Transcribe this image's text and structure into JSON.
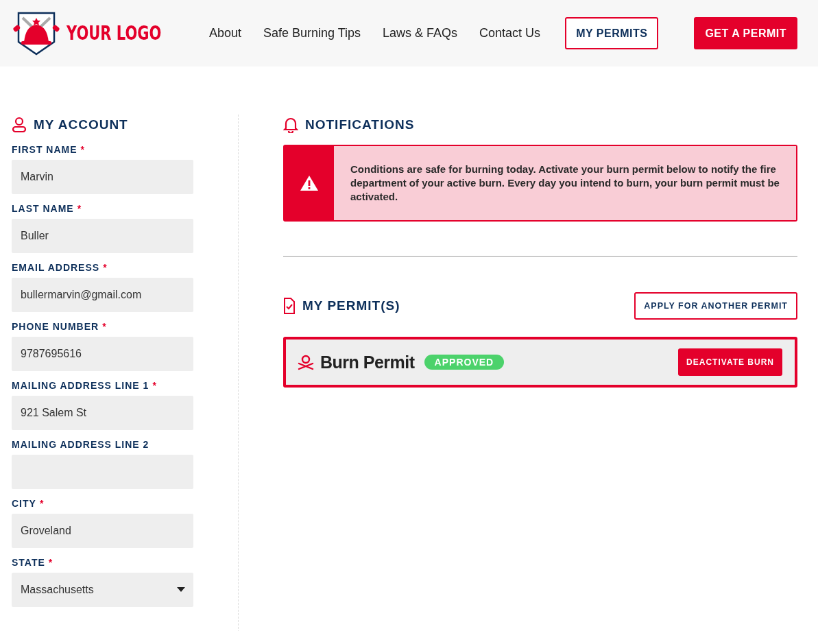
{
  "header": {
    "logo_text": "YOUR LOGO",
    "nav": [
      {
        "label": "About"
      },
      {
        "label": "Safe Burning Tips"
      },
      {
        "label": "Laws & FAQs"
      },
      {
        "label": "Contact Us"
      }
    ],
    "buttons": [
      {
        "label": "MY PERMITS",
        "kind": "outline"
      },
      {
        "label": "GET A PERMIT",
        "kind": "solid"
      }
    ]
  },
  "account": {
    "title": "MY ACCOUNT",
    "fields": [
      {
        "label": "FIRST NAME",
        "required_mark": "*",
        "value": "Marvin",
        "kind": "text"
      },
      {
        "label": "LAST NAME",
        "required_mark": "*",
        "value": "Buller",
        "kind": "text"
      },
      {
        "label": "EMAIL ADDRESS",
        "required_mark": "*",
        "value": "bullermarvin@gmail.com",
        "kind": "text"
      },
      {
        "label": "PHONE NUMBER",
        "required_mark": "*",
        "value": "9787695616",
        "kind": "text"
      },
      {
        "label": "MAILING ADDRESS LINE 1",
        "required_mark": "*",
        "value": "921 Salem St",
        "kind": "text"
      },
      {
        "label": "MAILING ADDRESS LINE 2",
        "kind": "text"
      },
      {
        "label": "CITY",
        "required_mark": "*",
        "value": "Groveland",
        "kind": "text"
      },
      {
        "label": "STATE",
        "required_mark": "*",
        "value": "Massachusetts",
        "kind": "select"
      }
    ]
  },
  "notifications": {
    "title": "NOTIFICATIONS",
    "alert": "Conditions are safe for burning today. Activate your burn permit below to notify the fire department of your active burn. Every day you intend to burn, your burn permit must be activated."
  },
  "permits": {
    "title": "MY PERMIT(S)",
    "apply_button": "APPLY FOR ANOTHER PERMIT",
    "items": [
      {
        "name": "Burn Permit",
        "status": "APPROVED",
        "color": "#4cd26b",
        "action": "DEACTIVATE BURN"
      }
    ]
  }
}
